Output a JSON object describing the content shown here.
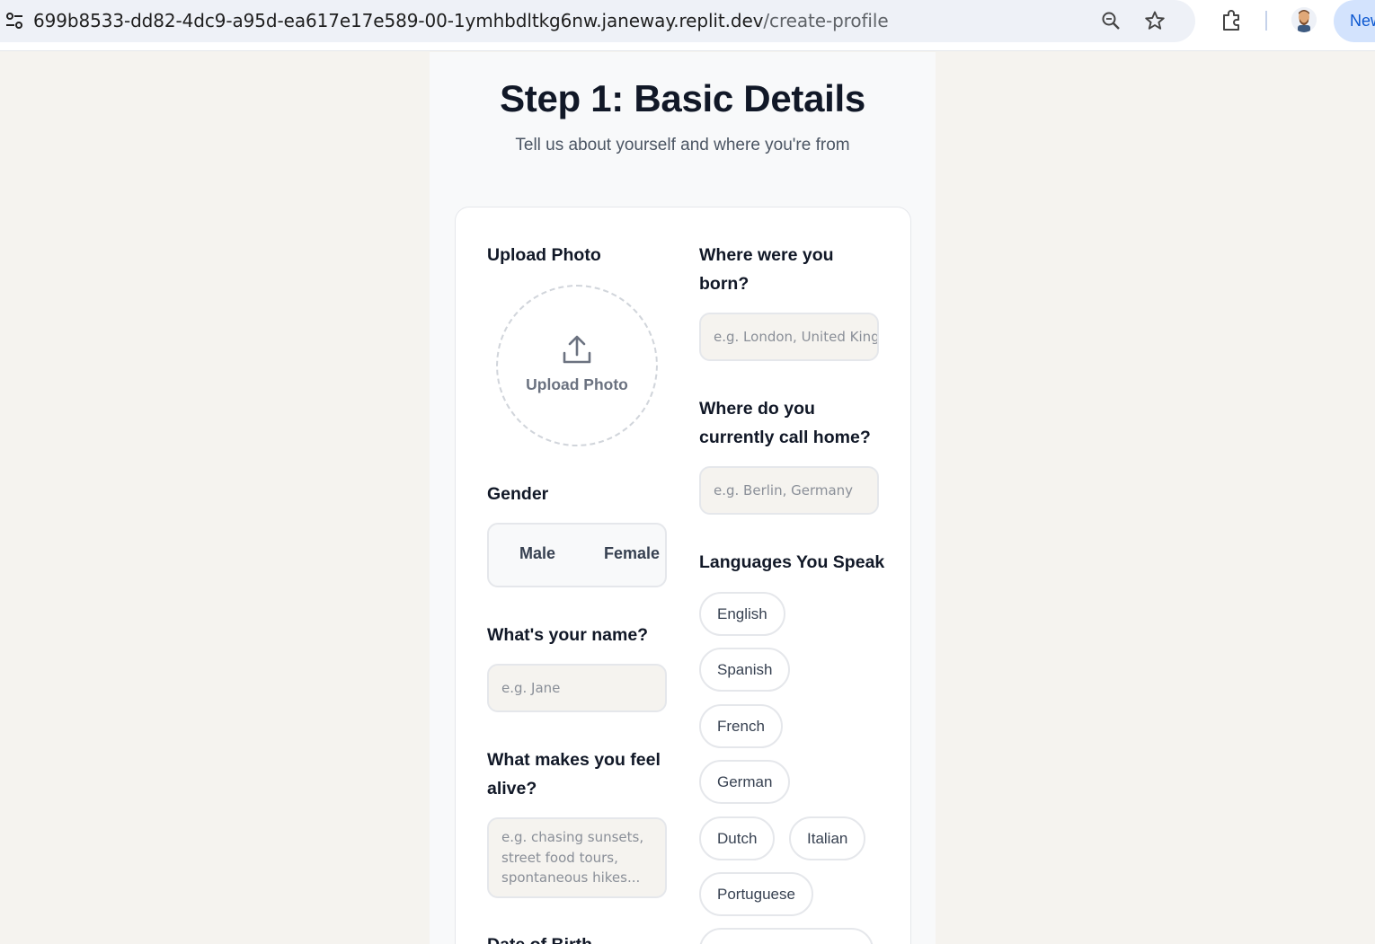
{
  "browser": {
    "url_host": "699b8533-dd82-4dc9-a95d-ea617e17e589-00-1ymhbdltkg6nw.janeway.replit.dev",
    "url_path": "/create-profile",
    "new_label": "New"
  },
  "page": {
    "title": "Step 1: Basic Details",
    "subtitle": "Tell us about yourself and where you're from"
  },
  "form": {
    "upload": {
      "label": "Upload Photo",
      "button_text": "Upload Photo"
    },
    "gender": {
      "label": "Gender",
      "options": [
        "Male",
        "Female"
      ]
    },
    "name": {
      "label": "What's your name?",
      "placeholder": "e.g. Jane"
    },
    "alive": {
      "label": "What makes you feel alive?",
      "placeholder": "e.g. chasing sunsets, street food tours, spontaneous hikes..."
    },
    "dob": {
      "label": "Date of Birth"
    },
    "born": {
      "label": "Where were you born?",
      "placeholder": "e.g. London, United Kingdom"
    },
    "home": {
      "label": "Where do you currently call home?",
      "placeholder": "e.g. Berlin, Germany"
    },
    "languages": {
      "label": "Languages You Speak",
      "options": [
        "English",
        "Spanish",
        "French",
        "German",
        "Dutch",
        "Italian",
        "Portuguese"
      ]
    }
  },
  "icons": [
    "tune-icon",
    "zoom-icon",
    "star-icon",
    "extensions-icon",
    "avatar",
    "upload-icon"
  ],
  "colors": {
    "accent_blue": "#0b57d0",
    "card_bg": "#ffffff",
    "page_bg": "#f5f3ef"
  }
}
